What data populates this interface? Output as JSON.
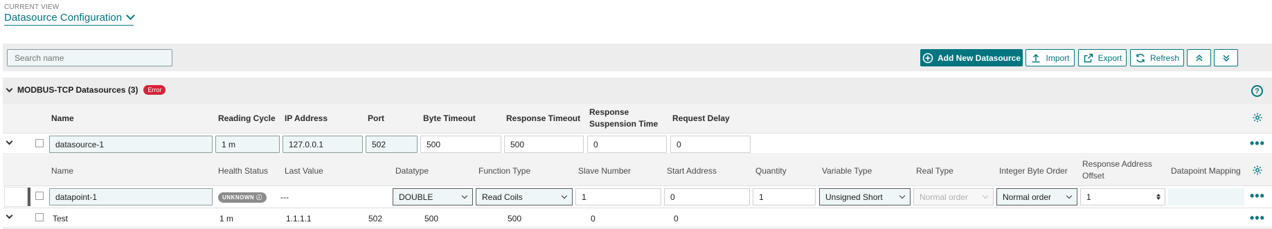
{
  "header": {
    "caption": "CURRENT VIEW",
    "title": "Datasource Configuration"
  },
  "toolbar": {
    "search_placeholder": "Search name",
    "add_label": "Add New Datasource",
    "import_label": "Import",
    "export_label": "Export",
    "refresh_label": "Refresh"
  },
  "section": {
    "title": "MODBUS-TCP Datasources (3)",
    "badge": "Error",
    "help": "?"
  },
  "datasource_columns": {
    "name": "Name",
    "reading_cycle": "Reading Cycle",
    "ip_address": "IP Address",
    "port": "Port",
    "byte_timeout": "Byte Timeout",
    "response_timeout": "Response Timeout",
    "response_suspension_1": "Response",
    "response_suspension_2": "Suspension Time",
    "request_delay": "Request Delay"
  },
  "datasource_1": {
    "name": "datasource-1",
    "reading_cycle": "1 m",
    "ip_address": "127.0.0.1",
    "port": "502",
    "byte_timeout": "500",
    "response_timeout": "500",
    "response_suspension_time": "0",
    "request_delay": "0"
  },
  "datapoint_columns": {
    "name": "Name",
    "health_status": "Health Status",
    "last_value": "Last Value",
    "datatype": "Datatype",
    "function_type": "Function Type",
    "slave_number": "Slave Number",
    "start_address": "Start Address",
    "quantity": "Quantity",
    "variable_type": "Variable Type",
    "real_type": "Real Type",
    "integer_byte_order": "Integer Byte Order",
    "response_address_1": "Response Address",
    "response_address_2": "Offset",
    "datapoint_mapping": "Datapoint Mapping"
  },
  "datapoint_1": {
    "name": "datapoint-1",
    "health_status": "UNKNOWN",
    "last_value": "---",
    "datatype": "DOUBLE",
    "function_type": "Read Coils",
    "slave_number": "1",
    "start_address": "0",
    "quantity": "1",
    "variable_type": "Unsigned Short",
    "real_type": "Normal order",
    "integer_byte_order": "Normal order",
    "response_address_offset": "1"
  },
  "datasource_2": {
    "name": "Test",
    "reading_cycle": "1 m",
    "ip_address": "1.1.1.1",
    "port": "502",
    "byte_timeout": "500",
    "response_timeout": "500",
    "response_suspension_time": "0",
    "request_delay": "0"
  },
  "colors": {
    "accent": "#00757f",
    "error": "#d72339",
    "toolbar_bg": "#ededed"
  }
}
